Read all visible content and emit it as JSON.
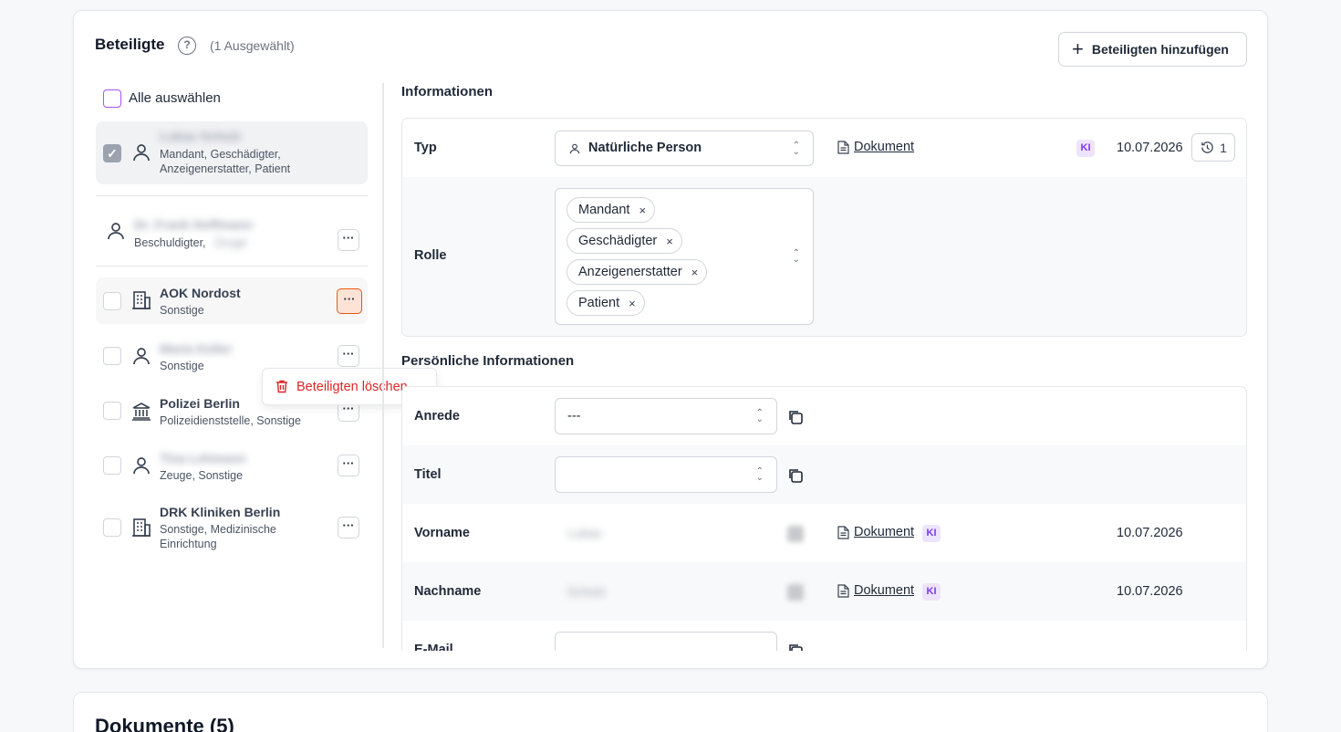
{
  "header": {
    "title": "Beteiligte",
    "help_icon": "question-circle-icon",
    "selection_count": "(1 Ausgewählt)",
    "add_button": "Beteiligten hinzufügen"
  },
  "list": {
    "select_all": "Alle auswählen",
    "items": [
      {
        "name": "Lukas Schulz",
        "roles": "Mandant, Geschädigter,",
        "roles2": "Anzeigenerstatter, Patient",
        "icon": "person-icon",
        "checked": true
      },
      {
        "name": "Dr. Frank Hoffmann",
        "roles": "Beschuldigter,",
        "roles2": "Zeuge",
        "icon": "person-icon"
      },
      {
        "name": "AOK Nordost",
        "roles": "Sonstige",
        "icon": "building-icon"
      },
      {
        "name": "Maria Keller",
        "roles": "Sonstige",
        "icon": "person-icon"
      },
      {
        "name": "Polizei Berlin",
        "roles": "Polizeidienststelle, Sonstige",
        "icon": "bank-icon"
      },
      {
        "name": "Tina Lehmann",
        "roles": "Zeuge, Sonstige",
        "icon": "person-icon"
      },
      {
        "name": "DRK Kliniken Berlin",
        "roles": "Sonstige, Medizinische",
        "roles2": "Einrichtung",
        "icon": "building-icon"
      }
    ],
    "more_label": "···"
  },
  "context_menu": {
    "delete_label": "Beteiligten löschen"
  },
  "info": {
    "section_title": "Informationen",
    "typ_label": "Typ",
    "typ_value": "Natürliche Person",
    "doc_label": "Dokument",
    "ki_label": "KI",
    "date": "10.07.2026",
    "history_count": "1",
    "rolle_label": "Rolle",
    "roles": [
      "Mandant",
      "Geschädigter",
      "Anzeigenerstatter",
      "Patient"
    ],
    "chip_remove": "×"
  },
  "personal": {
    "section_title": "Persönliche Informationen",
    "anrede_label": "Anrede",
    "anrede_value": "---",
    "titel_label": "Titel",
    "titel_value": "",
    "vorname_label": "Vorname",
    "vorname_value": "Lukas",
    "nachname_label": "Nachname",
    "nachname_value": "Schulz",
    "email_label": "E-Mail",
    "doc_label": "Dokument",
    "ki_label": "KI",
    "date": "10.07.2026"
  },
  "documents": {
    "title": "Dokumente (5)"
  }
}
